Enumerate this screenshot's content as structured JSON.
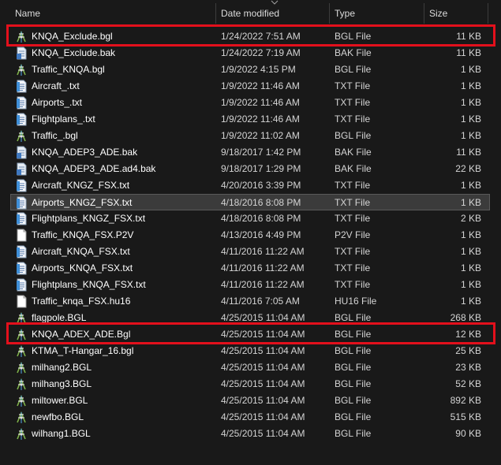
{
  "columns": {
    "name": "Name",
    "date": "Date modified",
    "type": "Type",
    "size": "Size"
  },
  "sort": {
    "column": "date",
    "icon": "sort-chevron-icon"
  },
  "highlight_color": "#e3101c",
  "files": [
    {
      "name": "KNQA_Exclude.bgl",
      "date": "1/24/2022 7:51 AM",
      "type": "BGL File",
      "size": "11 KB",
      "icon": "bgl-file-icon",
      "highlighted": true
    },
    {
      "name": "KNQA_Exclude.bak",
      "date": "1/24/2022 7:19 AM",
      "type": "BAK File",
      "size": "11 KB",
      "icon": "bak-file-icon"
    },
    {
      "name": "Traffic_KNQA.bgl",
      "date": "1/9/2022 4:15 PM",
      "type": "BGL File",
      "size": "1 KB",
      "icon": "bgl-file-icon"
    },
    {
      "name": "Aircraft_.txt",
      "date": "1/9/2022 11:46 AM",
      "type": "TXT File",
      "size": "1 KB",
      "icon": "txt-file-icon"
    },
    {
      "name": "Airports_.txt",
      "date": "1/9/2022 11:46 AM",
      "type": "TXT File",
      "size": "1 KB",
      "icon": "txt-file-icon"
    },
    {
      "name": "Flightplans_.txt",
      "date": "1/9/2022 11:46 AM",
      "type": "TXT File",
      "size": "1 KB",
      "icon": "txt-file-icon"
    },
    {
      "name": "Traffic_.bgl",
      "date": "1/9/2022 11:02 AM",
      "type": "BGL File",
      "size": "1 KB",
      "icon": "bgl-file-icon"
    },
    {
      "name": "KNQA_ADEP3_ADE.bak",
      "date": "9/18/2017 1:42 PM",
      "type": "BAK File",
      "size": "11 KB",
      "icon": "bak-file-icon"
    },
    {
      "name": "KNQA_ADEP3_ADE.ad4.bak",
      "date": "9/18/2017 1:29 PM",
      "type": "BAK File",
      "size": "22 KB",
      "icon": "bak-file-icon"
    },
    {
      "name": "Aircraft_KNGZ_FSX.txt",
      "date": "4/20/2016 3:39 PM",
      "type": "TXT File",
      "size": "1 KB",
      "icon": "txt-file-icon"
    },
    {
      "name": "Airports_KNGZ_FSX.txt",
      "date": "4/18/2016 8:08 PM",
      "type": "TXT File",
      "size": "1 KB",
      "icon": "txt-file-icon",
      "selected": true
    },
    {
      "name": "Flightplans_KNGZ_FSX.txt",
      "date": "4/18/2016 8:08 PM",
      "type": "TXT File",
      "size": "2 KB",
      "icon": "txt-file-icon"
    },
    {
      "name": "Traffic_KNQA_FSX.P2V",
      "date": "4/13/2016 4:49 PM",
      "type": "P2V File",
      "size": "1 KB",
      "icon": "blank-file-icon"
    },
    {
      "name": "Aircraft_KNQA_FSX.txt",
      "date": "4/11/2016 11:22 AM",
      "type": "TXT File",
      "size": "1 KB",
      "icon": "txt-file-icon"
    },
    {
      "name": "Airports_KNQA_FSX.txt",
      "date": "4/11/2016 11:22 AM",
      "type": "TXT File",
      "size": "1 KB",
      "icon": "txt-file-icon"
    },
    {
      "name": "Flightplans_KNQA_FSX.txt",
      "date": "4/11/2016 11:22 AM",
      "type": "TXT File",
      "size": "1 KB",
      "icon": "txt-file-icon"
    },
    {
      "name": "Traffic_knqa_FSX.hu16",
      "date": "4/11/2016 7:05 AM",
      "type": "HU16 File",
      "size": "1 KB",
      "icon": "blank-file-icon"
    },
    {
      "name": "flagpole.BGL",
      "date": "4/25/2015 11:04 AM",
      "type": "BGL File",
      "size": "268 KB",
      "icon": "bgl-file-icon"
    },
    {
      "name": "KNQA_ADEX_ADE.Bgl",
      "date": "4/25/2015 11:04 AM",
      "type": "BGL File",
      "size": "12 KB",
      "icon": "bgl-file-icon",
      "highlighted": true
    },
    {
      "name": "KTMA_T-Hangar_16.bgl",
      "date": "4/25/2015 11:04 AM",
      "type": "BGL File",
      "size": "25 KB",
      "icon": "bgl-file-icon"
    },
    {
      "name": "milhang2.BGL",
      "date": "4/25/2015 11:04 AM",
      "type": "BGL File",
      "size": "23 KB",
      "icon": "bgl-file-icon"
    },
    {
      "name": "milhang3.BGL",
      "date": "4/25/2015 11:04 AM",
      "type": "BGL File",
      "size": "52 KB",
      "icon": "bgl-file-icon"
    },
    {
      "name": "miltower.BGL",
      "date": "4/25/2015 11:04 AM",
      "type": "BGL File",
      "size": "892 KB",
      "icon": "bgl-file-icon"
    },
    {
      "name": "newfbo.BGL",
      "date": "4/25/2015 11:04 AM",
      "type": "BGL File",
      "size": "515 KB",
      "icon": "bgl-file-icon"
    },
    {
      "name": "wilhang1.BGL",
      "date": "4/25/2015 11:04 AM",
      "type": "BGL File",
      "size": "90 KB",
      "icon": "bgl-file-icon"
    }
  ]
}
